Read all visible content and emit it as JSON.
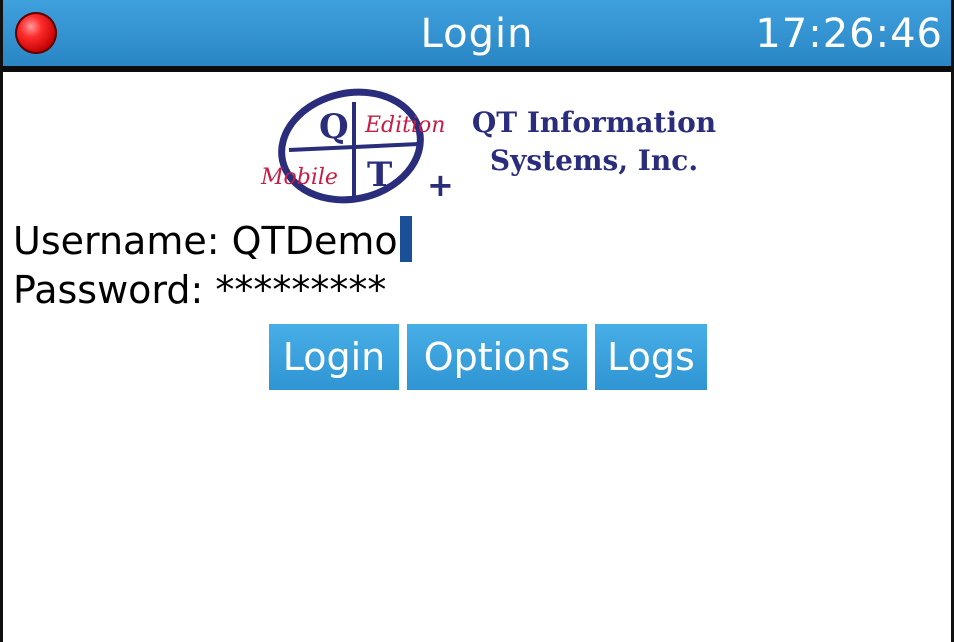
{
  "header": {
    "title": "Login",
    "time": "17:26:46",
    "status_icon": "red-record-dot"
  },
  "logo": {
    "letter_top": "Q",
    "letter_bottom": "T",
    "word_top": "Edition",
    "word_bottom": "Mobile",
    "plus": "+",
    "company_line1": "QT Information",
    "company_line2": "Systems, Inc."
  },
  "form": {
    "username_label": "Username:",
    "username_value": "QTDemo",
    "password_label": "Password:",
    "password_value": "*********"
  },
  "buttons": {
    "login": "Login",
    "options": "Options",
    "logs": "Logs"
  },
  "colors": {
    "header_blue": "#2f95d3",
    "company_navy": "#2a2c7c",
    "logo_red": "#c81e46",
    "cursor": "#1b4f97"
  }
}
